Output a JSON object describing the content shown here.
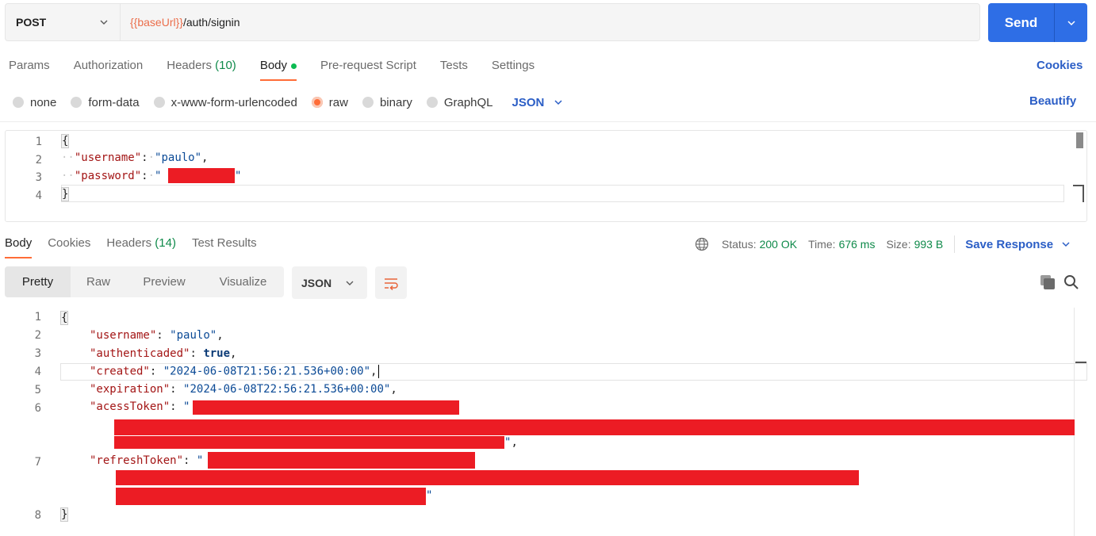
{
  "request": {
    "method": "POST",
    "url_variable": "{{baseUrl}}",
    "url_path": "/auth/signin",
    "send_label": "Send"
  },
  "request_tabs": [
    {
      "label": "Params"
    },
    {
      "label": "Authorization"
    },
    {
      "label": "Headers",
      "count": "(10)"
    },
    {
      "label": "Body",
      "active": true
    },
    {
      "label": "Pre-request Script"
    },
    {
      "label": "Tests"
    },
    {
      "label": "Settings"
    }
  ],
  "cookies_label": "Cookies",
  "body_modes": [
    "none",
    "form-data",
    "x-www-form-urlencoded",
    "raw",
    "binary",
    "GraphQL"
  ],
  "body_mode_selected": "raw",
  "body_format": "JSON",
  "beautify_label": "Beautify",
  "request_body": {
    "line_numbers": [
      "1",
      "2",
      "3",
      "4"
    ],
    "open_brace": "{",
    "close_brace": "}",
    "username_key": "\"username\"",
    "username_value": "\"paulo\"",
    "password_key": "\"password\"",
    "password_quote_open": "\"",
    "password_quote_close": "\"",
    "colon": ":",
    "comma": ","
  },
  "response_tabs": [
    {
      "label": "Body",
      "active": true
    },
    {
      "label": "Cookies"
    },
    {
      "label": "Headers",
      "count": "(14)"
    },
    {
      "label": "Test Results"
    }
  ],
  "status": {
    "status_label": "Status:",
    "status_value": "200 OK",
    "time_label": "Time:",
    "time_value": "676 ms",
    "size_label": "Size:",
    "size_value": "993 B"
  },
  "save_response_label": "Save Response",
  "view_modes": [
    "Pretty",
    "Raw",
    "Preview",
    "Visualize"
  ],
  "response_format": "JSON",
  "response_body": {
    "line_numbers": [
      "1",
      "2",
      "3",
      "4",
      "5",
      "6",
      "7",
      "8"
    ],
    "open_brace": "{",
    "close_brace": "}",
    "username_key": "\"username\"",
    "username_value": "\"paulo\"",
    "authenticaded_key": "\"authenticaded\"",
    "authenticaded_value": "true",
    "created_key": "\"created\"",
    "created_value": "\"2024-06-08T21:56:21.536+00:00\"",
    "expiration_key": "\"expiration\"",
    "expiration_value": "\"2024-06-08T22:56:21.536+00:00\"",
    "acess_token_key": "\"acessToken\"",
    "refresh_token_key": "\"refreshToken\"",
    "quote": "\"",
    "colon": ":",
    "comma": ","
  },
  "icons": {
    "globe": "globe-icon",
    "copy": "copy-icon",
    "search": "search-icon",
    "wrap": "wrap-lines-icon",
    "chevron": "chevron-down-icon"
  },
  "colors": {
    "accent_orange": "#ff6c37",
    "send_blue": "#2e6ee6",
    "link_blue": "#2b5ec6",
    "status_green": "#0f8a4a",
    "redaction_red": "#ec1c24"
  }
}
